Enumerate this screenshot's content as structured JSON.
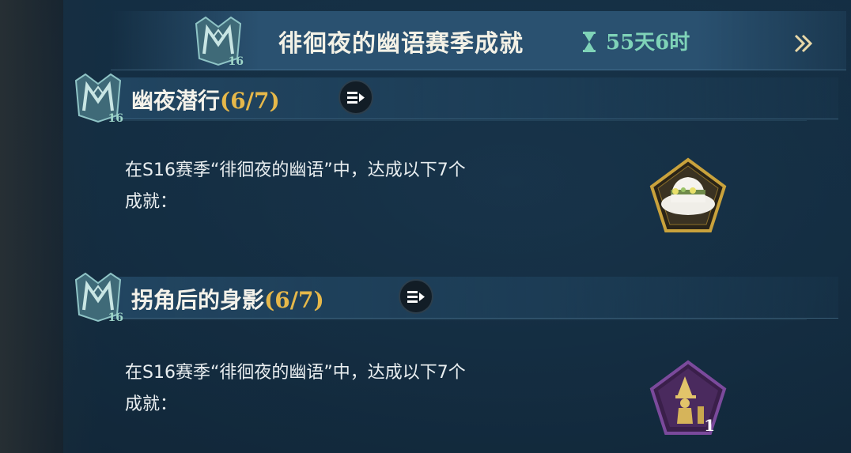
{
  "season": {
    "emblem_number": "16",
    "title": "徘徊夜的幽语赛季成就",
    "timer": "55天6时"
  },
  "achievements": [
    {
      "emblem_number": "16",
      "name": "幽夜潜行",
      "progress": "(6/7)",
      "description_line1": "在S16赛季“徘徊夜的幽语”中，达成以下7个",
      "description_line2": "成就：",
      "reward_icon": "white-flower-hat-icon",
      "reward_qty": ""
    },
    {
      "emblem_number": "16",
      "name": "拐角后的身影",
      "progress": "(6/7)",
      "description_line1": "在S16赛季“徘徊夜的幽语”中，达成以下7个",
      "description_line2": "成就：",
      "reward_icon": "witch-figure-icon",
      "reward_qty": "1"
    }
  ],
  "colors": {
    "progress": "#e6b84a",
    "timer": "#7fd3b8",
    "gold_frame": "#c9a23c",
    "purple_frame": "#6a3c8c"
  }
}
